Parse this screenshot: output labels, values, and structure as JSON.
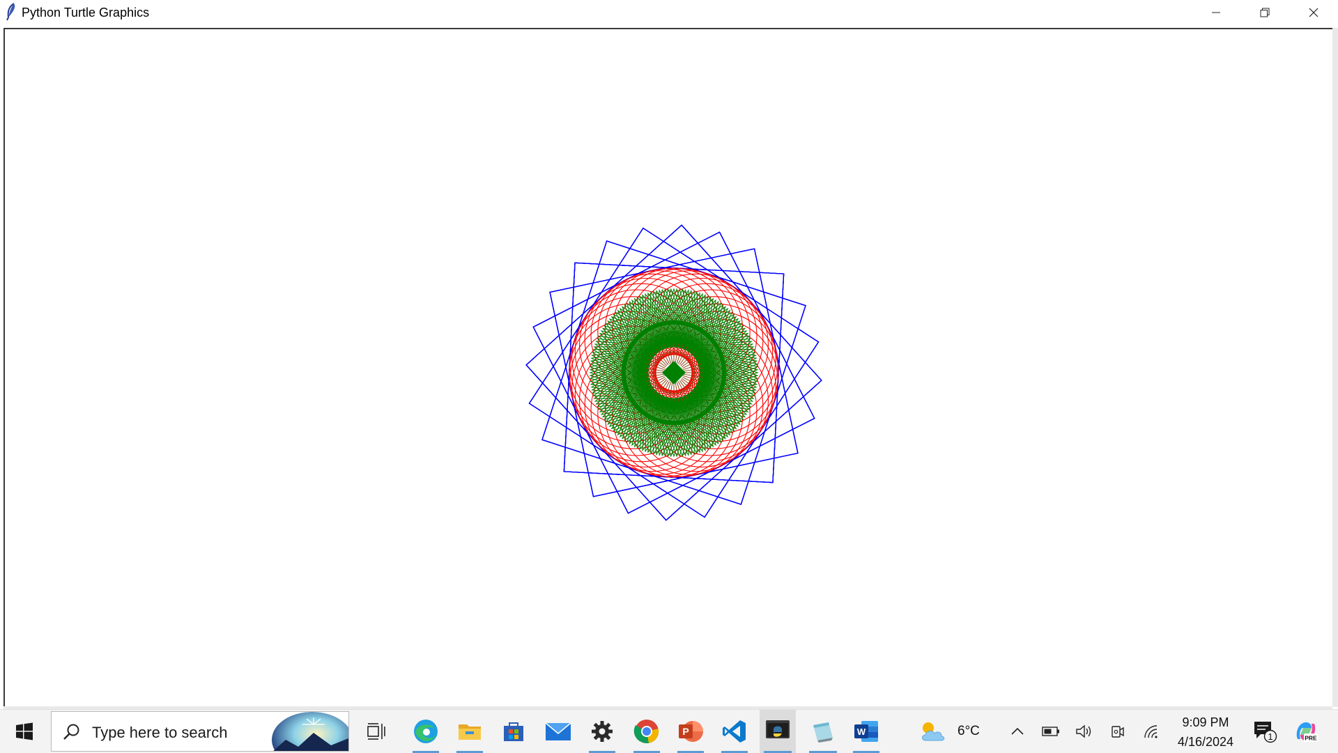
{
  "window": {
    "title": "Python Turtle Graphics",
    "controls": [
      "minimize",
      "restore",
      "close"
    ]
  },
  "canvas": {
    "background": "#ffffff",
    "pattern_colors": {
      "outer_squares": "#0000ff",
      "middle_circles": "#ff0000",
      "inner_pattern": "#008000",
      "center": "#8b4513"
    }
  },
  "taskbar": {
    "search_placeholder": "Type here to search",
    "pinned_apps": [
      "task-view",
      "edge",
      "file-explorer",
      "microsoft-store",
      "mail",
      "settings",
      "chrome",
      "powerpoint",
      "vs-code",
      "python",
      "notepad",
      "word"
    ],
    "weather": {
      "temperature": "6°C",
      "icon": "partly-cloudy-icon"
    },
    "clock": {
      "time": "9:09 PM",
      "date": "4/16/2024"
    },
    "notifications_count": "1",
    "copilot_badge": "PRE"
  }
}
